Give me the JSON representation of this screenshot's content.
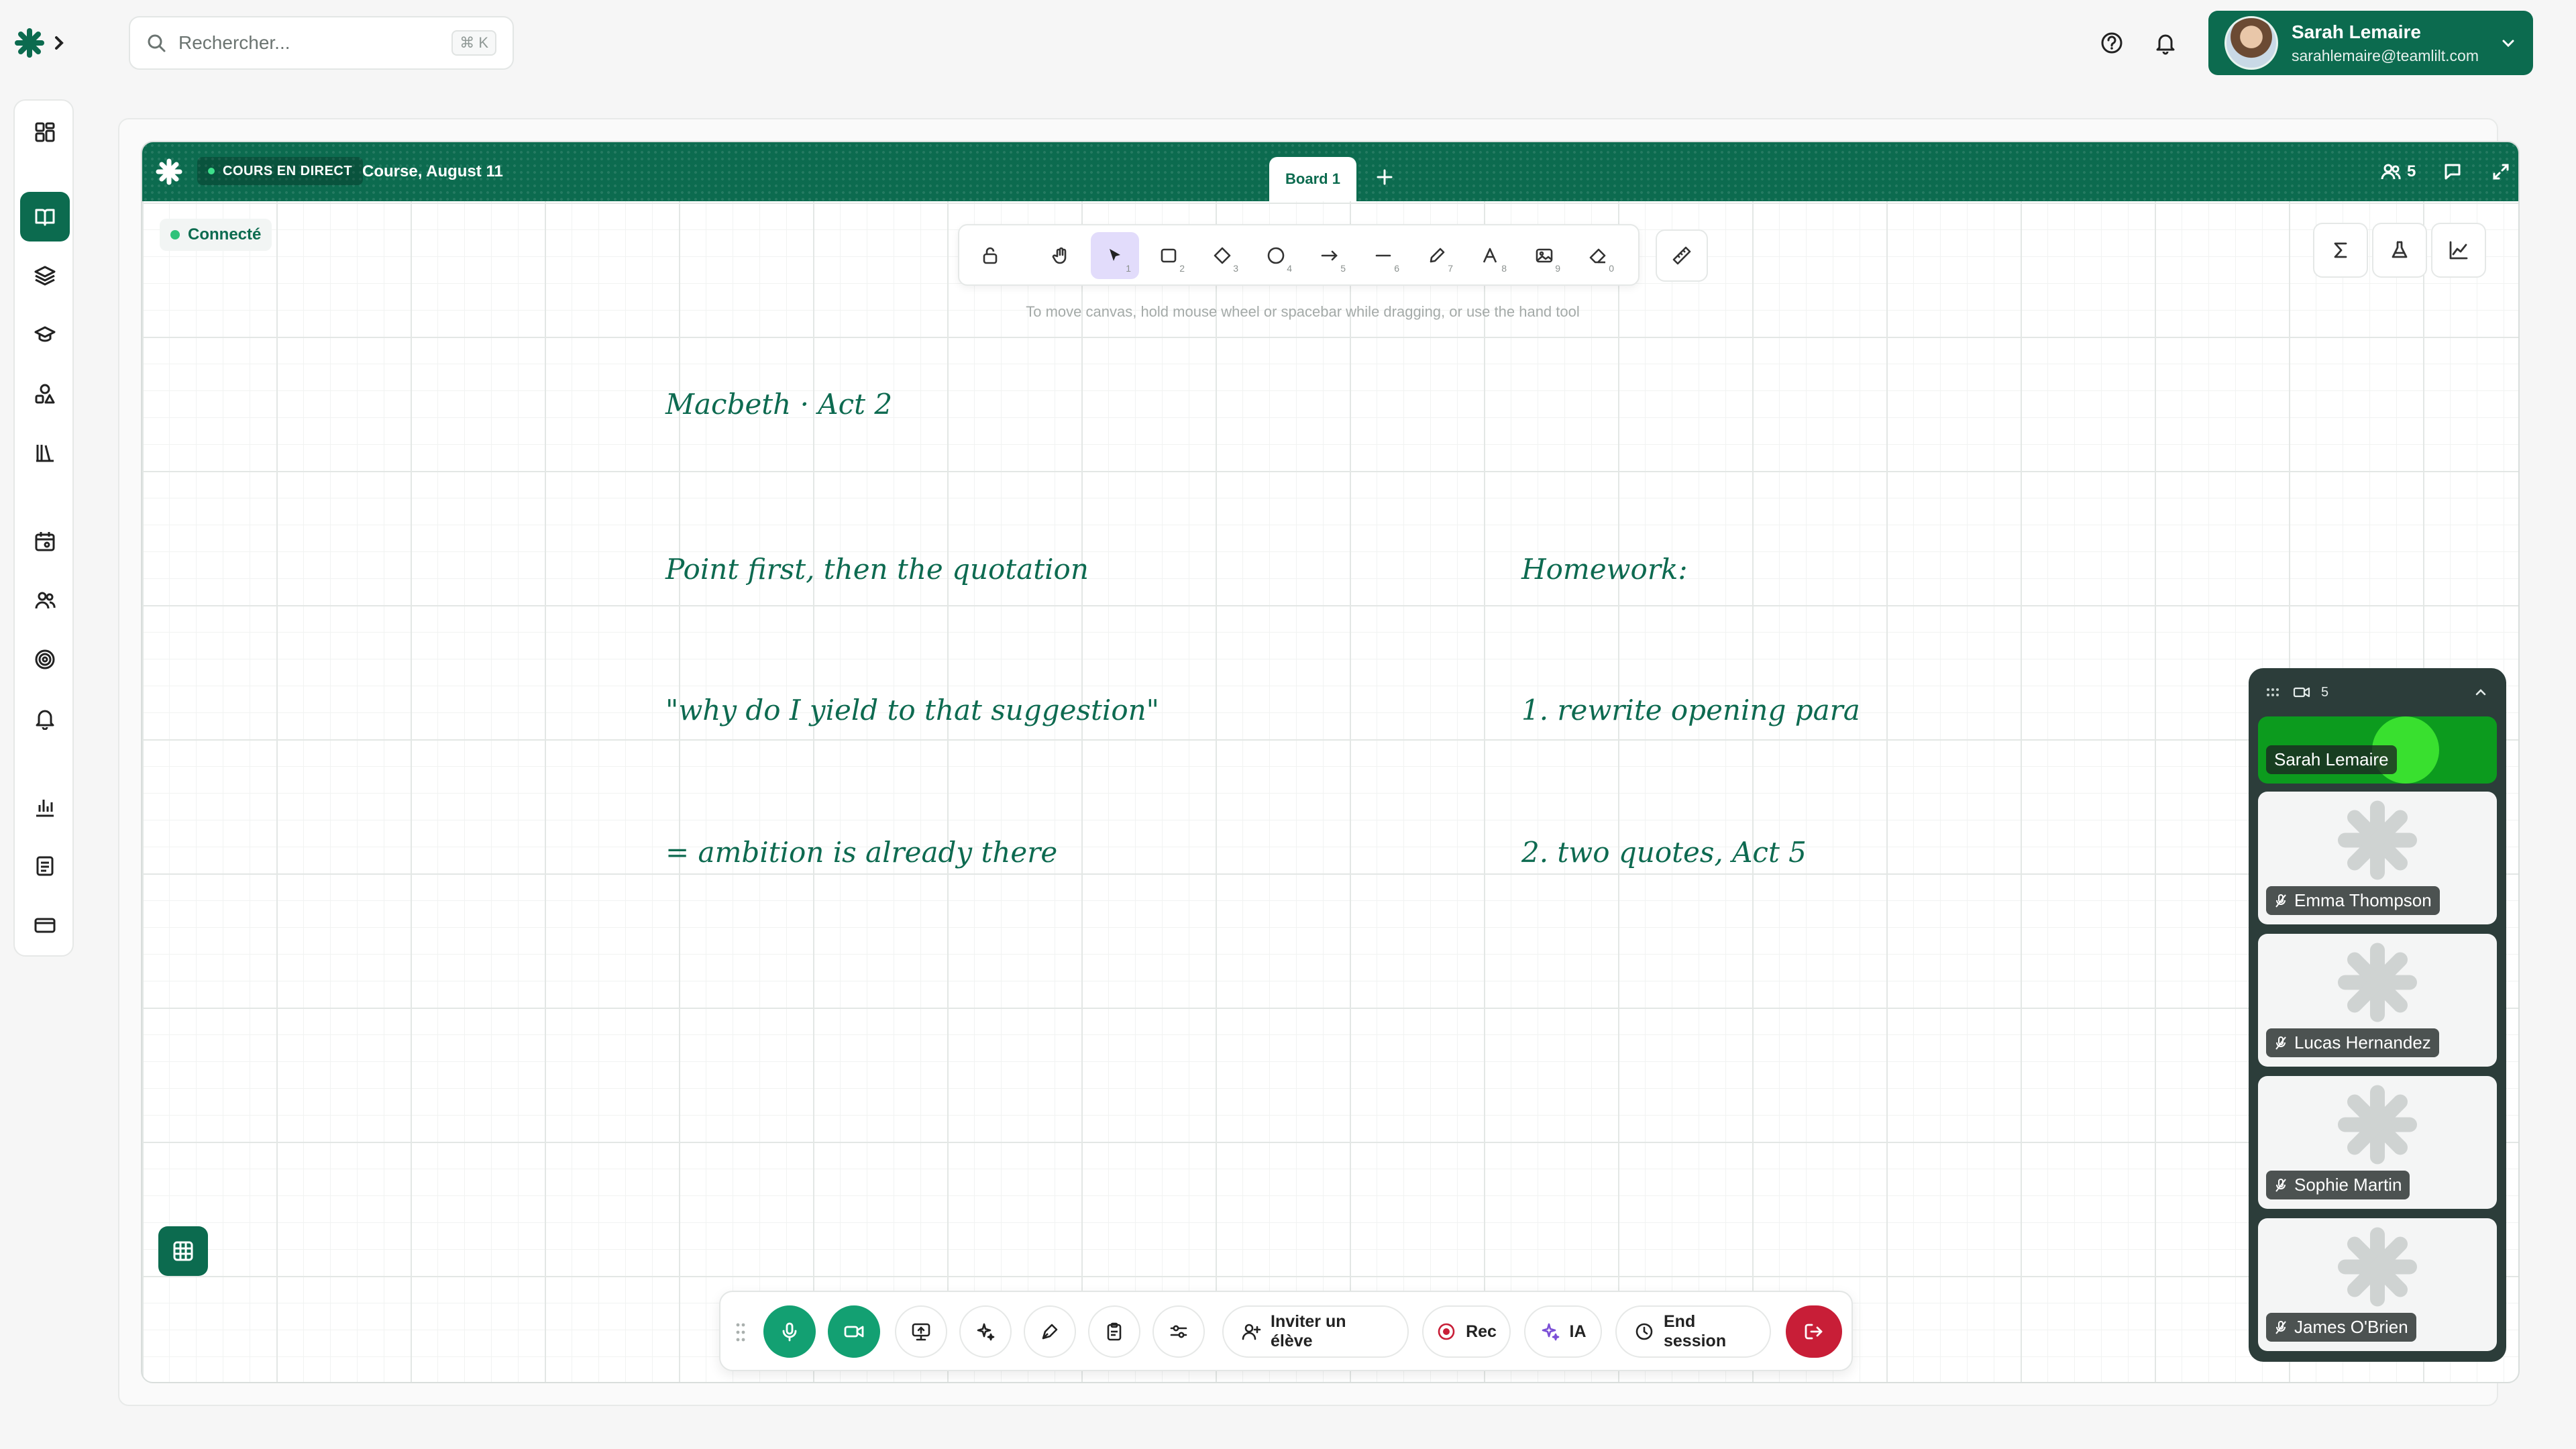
{
  "search": {
    "placeholder": "Rechercher...",
    "shortcut": "⌘ K"
  },
  "user": {
    "name": "Sarah Lemaire",
    "email": "sarahlemaire@teamlilt.com"
  },
  "session": {
    "live_label": "COURS EN DIRECT",
    "course_title": "Course, August 11",
    "board_tab": "Board 1",
    "participants_count": "5",
    "connected_label": "Connecté"
  },
  "canvas": {
    "hint": "To move canvas, hold mouse wheel or spacebar while dragging, or use the hand tool",
    "notes": {
      "title": "Macbeth · Act 2",
      "point": "Point first, then the quotation",
      "quote": "\"why do I yield to that suggestion\"",
      "ambition": "= ambition is already there",
      "homework": "Homework:",
      "hw1": "1. rewrite opening para",
      "hw2": "2. two quotes, Act 5"
    }
  },
  "tools": {
    "numbers": [
      "1",
      "2",
      "3",
      "4",
      "5",
      "6",
      "7",
      "8",
      "9",
      "0"
    ]
  },
  "controls": {
    "invite_label": "Inviter un élève",
    "rec_label": "Rec",
    "ai_label": "IA",
    "end_label": "End session"
  },
  "participants": {
    "count": "5",
    "speaking": "Sarah Lemaire",
    "peers": [
      "Emma Thompson",
      "Lucas Hernandez",
      "Sophie Martin",
      "James O'Brien"
    ]
  },
  "colors": {
    "brand": "#0c6b4f",
    "speaking": "#0c9b1e",
    "danger": "#c81e37",
    "active_tool": "#e2dcfb"
  },
  "icons": {
    "top": [
      "help-icon",
      "bell-icon",
      "chevron-down-icon"
    ],
    "rail": [
      "dashboard-icon",
      "book-icon",
      "layers-icon",
      "graduation-cap-icon",
      "shapes-icon",
      "library-icon",
      "calendar-icon",
      "users-icon",
      "target-icon",
      "bell-icon",
      "chart-icon",
      "document-icon",
      "card-icon"
    ]
  }
}
